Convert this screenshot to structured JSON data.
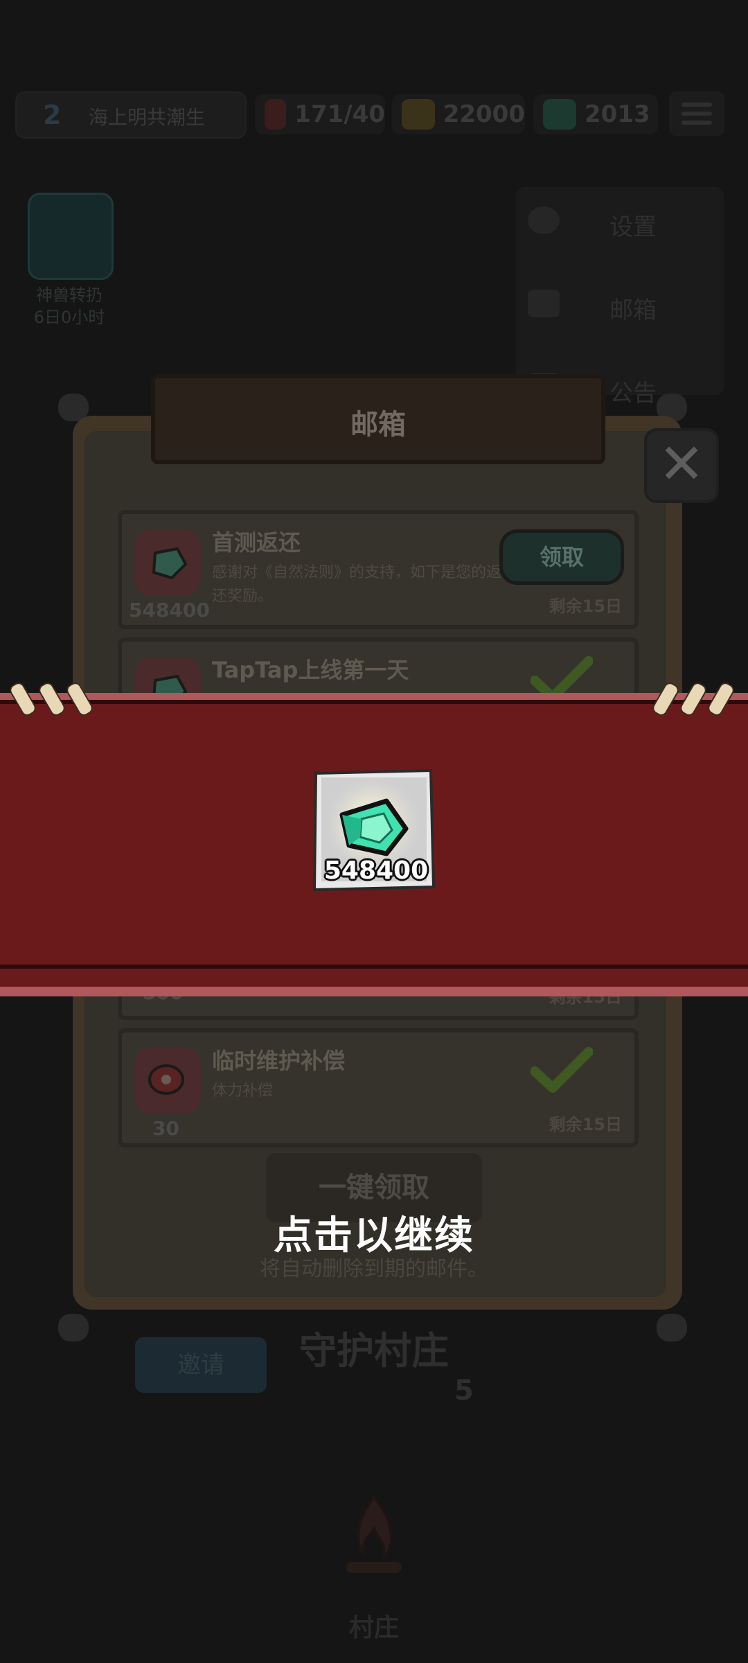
{
  "top_bar": {
    "level": "2",
    "player_name": "海上明共潮生",
    "stamina": "171/40",
    "gold": "22000",
    "gems": "2013",
    "menu_icon": "hamburger-icon"
  },
  "side_event": {
    "label_line1": "神兽转扔",
    "label_line2": "6日0小时"
  },
  "menu": {
    "items": [
      {
        "label": "设置",
        "icon": "gear-icon"
      },
      {
        "label": "邮箱",
        "icon": "mail-icon"
      },
      {
        "label": "公告",
        "icon": "megaphone-icon"
      }
    ]
  },
  "mailbox": {
    "title": "邮箱",
    "claim_all_label": "一键领取",
    "auto_delete_note": "将自动删除到期的邮件。",
    "mails": [
      {
        "title": "首测返还",
        "description": "感谢对《自然法则》的支持，如下是您的返还奖励。",
        "amount": "548400",
        "expire": "剩余15日",
        "action_label": "领取",
        "claimed": false,
        "icon": "gem-icon"
      },
      {
        "title": "TapTap上线第一天",
        "amount": "500",
        "expire": "剩余15日",
        "claimed": true,
        "icon": "gem-icon"
      },
      {
        "title": "临时维护补偿",
        "description": "体力补偿",
        "amount": "30",
        "expire": "剩余15日",
        "claimed": true,
        "icon": "meat-icon"
      }
    ]
  },
  "background": {
    "village_title": "守护村庄",
    "village_level": "5",
    "invite_label": "邀请",
    "bottom_tab": "村庄"
  },
  "reward_popup": {
    "icon": "gem-icon",
    "amount": "548400",
    "continue_text": "点击以继续"
  },
  "colors": {
    "banner": "#6b1a1b",
    "banner_border": "#b1585c",
    "gem": "#3fe3b0"
  }
}
